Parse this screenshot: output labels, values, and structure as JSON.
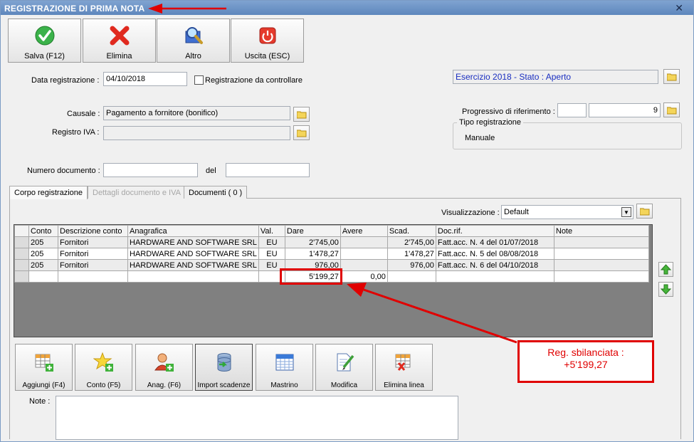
{
  "window": {
    "title": "REGISTRAZIONE DI PRIMA NOTA",
    "close_glyph": "✕"
  },
  "toolbar": {
    "save": "Salva (F12)",
    "delete": "Elimina",
    "other": "Altro",
    "exit": "Uscita (ESC)"
  },
  "form": {
    "date_label": "Data registrazione :",
    "date_value": "04/10/2018",
    "check_label": "Registrazione da controllare",
    "esercizio": "Esercizio 2018 - Stato : Aperto",
    "causale_label": "Causale :",
    "causale_value": "Pagamento a fornitore (bonifico)",
    "registro_label": "Registro IVA :",
    "registro_value": "",
    "progressivo_label": "Progressivo di riferimento :",
    "progressivo_a": "",
    "progressivo_b": "9",
    "tipo_label": "Tipo registrazione",
    "tipo_value": "Manuale",
    "numdoc_label": "Numero documento :",
    "numdoc_value": "",
    "del_label": "del",
    "del_value": ""
  },
  "tabs": [
    {
      "label": "Corpo registrazione"
    },
    {
      "label": "Dettagli documento e IVA"
    },
    {
      "label": "Documenti ( 0 )"
    }
  ],
  "view": {
    "label": "Visualizzazione :",
    "value": "Default"
  },
  "table": {
    "headers": [
      "Conto",
      "Descrizione conto",
      "Anagrafica",
      "Val.",
      "Dare",
      "Avere",
      "Scad.",
      "Doc.rif.",
      "Note"
    ],
    "rows": [
      [
        "205",
        "Fornitori",
        "HARDWARE AND SOFTWARE SRL",
        "EU",
        "2'745,00",
        "",
        "2'745,00",
        "Fatt.acc. N. 4 del 01/07/2018",
        ""
      ],
      [
        "205",
        "Fornitori",
        "HARDWARE AND SOFTWARE SRL",
        "EU",
        "1'478,27",
        "",
        "1'478,27",
        "Fatt.acc. N. 5 del 08/08/2018",
        ""
      ],
      [
        "205",
        "Fornitori",
        "HARDWARE AND SOFTWARE SRL",
        "EU",
        "976,00",
        "",
        "976,00",
        "Fatt.acc. N. 6 del 04/10/2018",
        ""
      ]
    ],
    "totals": {
      "dare": "5'199,27",
      "avere": "0,00"
    }
  },
  "bottom_buttons": {
    "add": "Aggiungi (F4)",
    "conto": "Conto (F5)",
    "anag": "Anag. (F6)",
    "import": "Import scadenze",
    "mastrino": "Mastrino",
    "modifica": "Modifica",
    "elimina_linea": "Elimina linea"
  },
  "note_label": "Note :",
  "note_value": "",
  "callout": {
    "line1": "Reg. sbilanciata :",
    "line2": "+5'199,27"
  },
  "colors": {
    "accent_red": "#e00000",
    "title_blue": "#5e87bd",
    "link_blue": "#1a2ec0"
  }
}
